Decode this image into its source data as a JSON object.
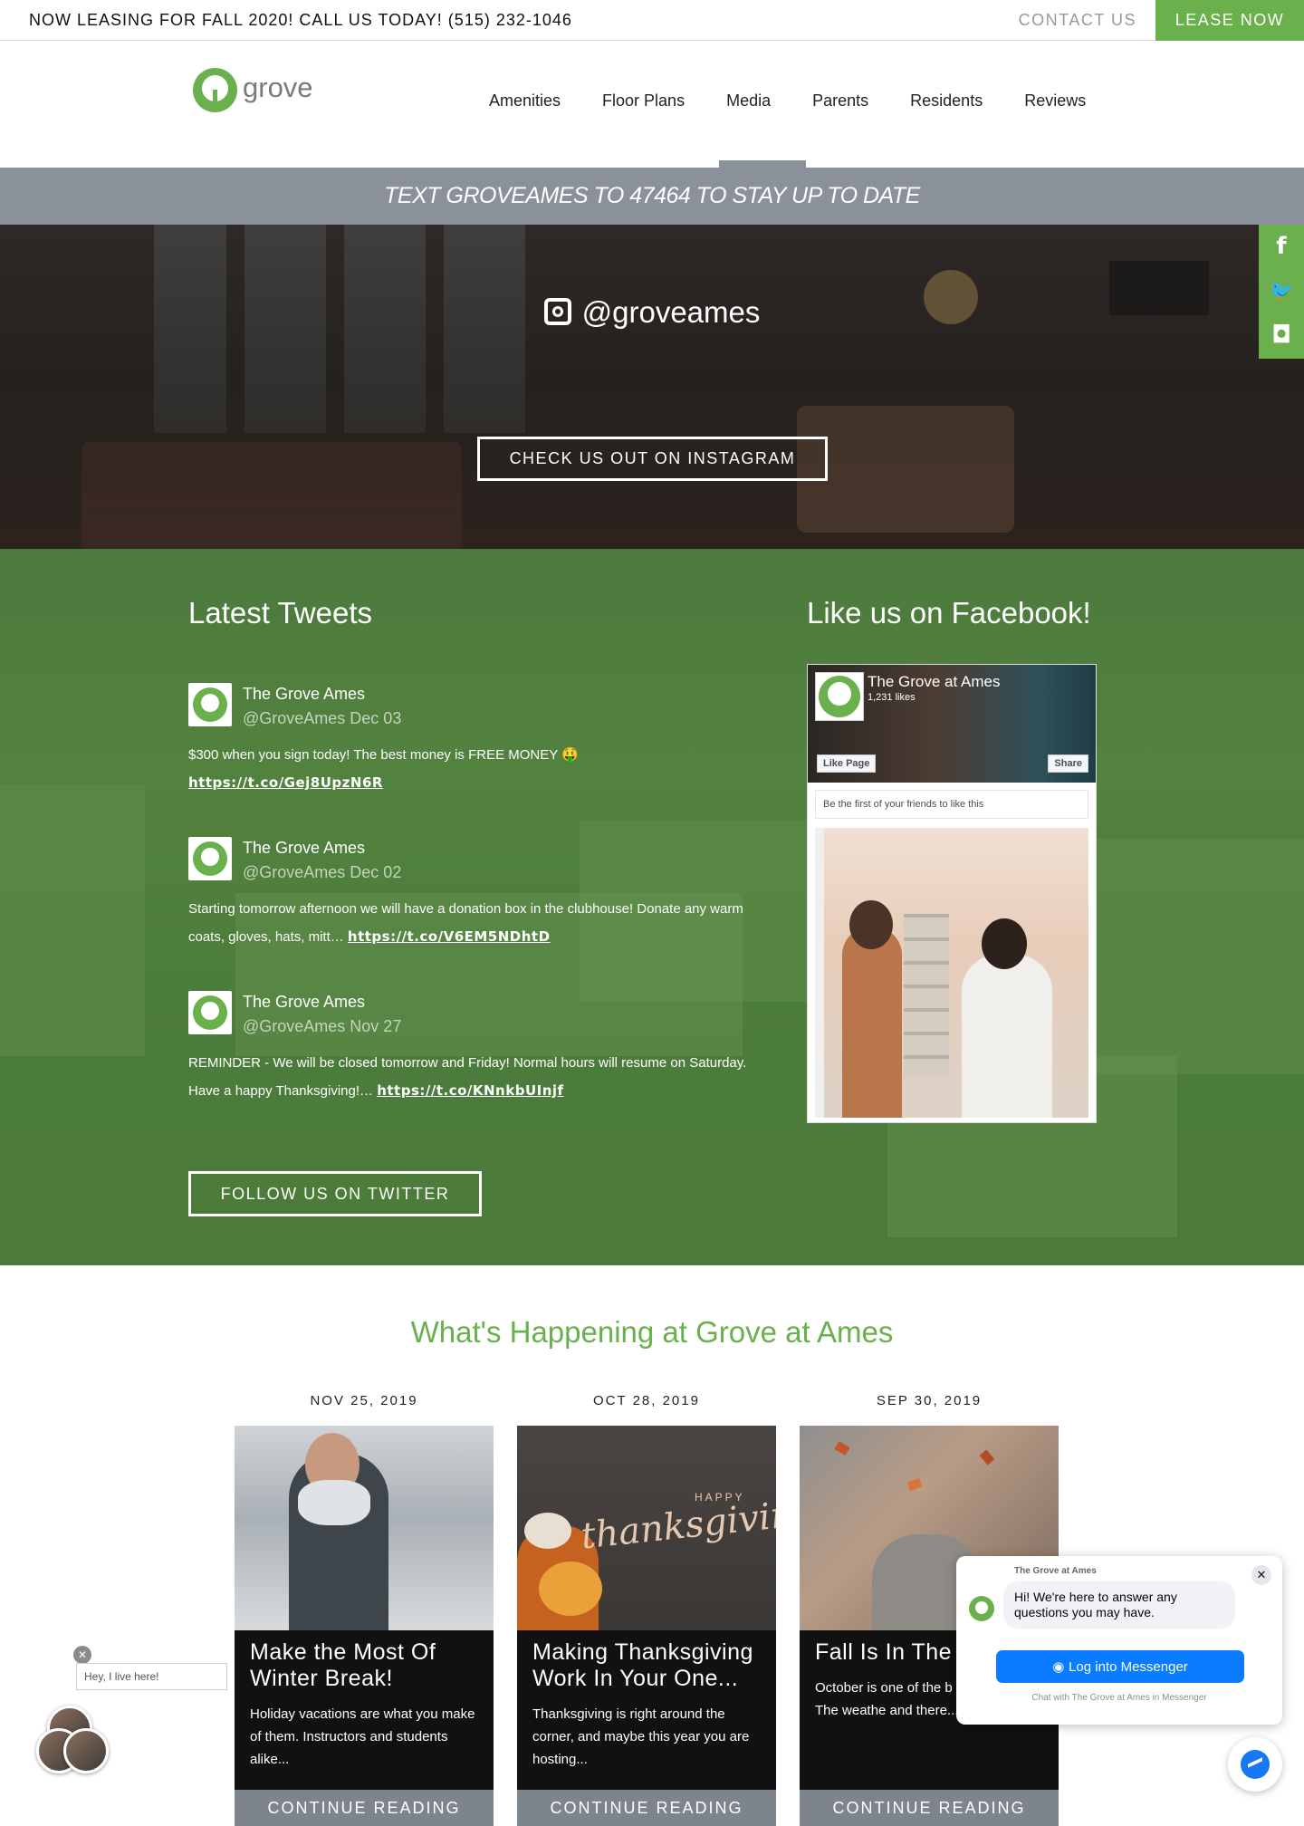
{
  "topbar": {
    "leasing_text": "NOW LEASING FOR FALL 2020! CALL US TODAY! (515) 232-1046",
    "contact_label": "CONTACT US",
    "lease_label": "LEASE NOW"
  },
  "header": {
    "logo_text": "grove",
    "nav": [
      "Amenities",
      "Floor Plans",
      "Media",
      "Parents",
      "Residents",
      "Reviews"
    ],
    "active_nav": "Media"
  },
  "banner": {
    "text": "TEXT GROVEAMES TO 47464 TO STAY UP TO DATE"
  },
  "hero": {
    "handle": "@groveames",
    "button_label": "CHECK US OUT ON INSTAGRAM"
  },
  "social_rail": {
    "items": [
      {
        "icon": "facebook-icon",
        "glyph": "f"
      },
      {
        "icon": "twitter-icon",
        "glyph": "🐦"
      },
      {
        "icon": "instagram-icon",
        "glyph": "◘"
      }
    ]
  },
  "tweets_section": {
    "heading": "Latest Tweets",
    "follow_label": "FOLLOW US ON TWITTER",
    "tweets": [
      {
        "name": "The Grove Ames",
        "handle_date": "@GroveAmes Dec 03",
        "text": "$300 when you sign today! The best money is FREE MONEY 🤑",
        "link": "https://t.co/Gej8UpzN6R"
      },
      {
        "name": "The Grove Ames",
        "handle_date": "@GroveAmes Dec 02",
        "text": "Starting tomorrow afternoon we will have a donation box in the clubhouse! Donate any warm coats, gloves, hats, mitt…",
        "link": "https://t.co/V6EM5NDhtD"
      },
      {
        "name": "The Grove Ames",
        "handle_date": "@GroveAmes Nov 27",
        "text": "REMINDER - We will be closed tomorrow and Friday! Normal hours will resume on Saturday. Have a happy Thanksgiving!…",
        "link": "https://t.co/KNnkbUInjf"
      }
    ]
  },
  "facebook": {
    "heading": "Like us on Facebook!",
    "page_name": "The Grove at Ames",
    "likes": "1,231 likes",
    "like_button": "Like Page",
    "share_button": "Share",
    "friends_text": "Be the first of your friends to like this"
  },
  "happening": {
    "heading": "What's Happening at Grove at Ames",
    "posts": [
      {
        "date": "NOV 25, 2019",
        "title": "Make the Most Of Winter Break!",
        "excerpt": "Holiday vacations are what you make of them. Instructors and students alike...",
        "cta": "CONTINUE READING"
      },
      {
        "date": "OCT 28, 2019",
        "title": "Making Thanksgiving Work In Your One...",
        "excerpt": "Thanksgiving is right around the corner, and maybe this year you are hosting...",
        "cta": "CONTINUE READING",
        "image_text_small": "HAPPY",
        "image_text_script": "thanksgiving"
      },
      {
        "date": "SEP 30, 2019",
        "title": "Fall Is In The A",
        "excerpt": "October is one of the b of the year. The weathe and there...",
        "cta": "CONTINUE READING"
      }
    ]
  },
  "chat": {
    "org_name": "The Grove at Ames",
    "message": "Hi! We're here to answer any questions you may have.",
    "login_label": "Log into Messenger",
    "sub_text": "Chat with The Grove at Ames in Messenger",
    "close_glyph": "✕"
  },
  "resident_widget": {
    "bubble_text": "Hey, I live here!",
    "close_glyph": "✕"
  },
  "colors": {
    "brand_green": "#6ab04c",
    "banner_gray": "#8a919a",
    "messenger_blue": "#0a7cff"
  }
}
